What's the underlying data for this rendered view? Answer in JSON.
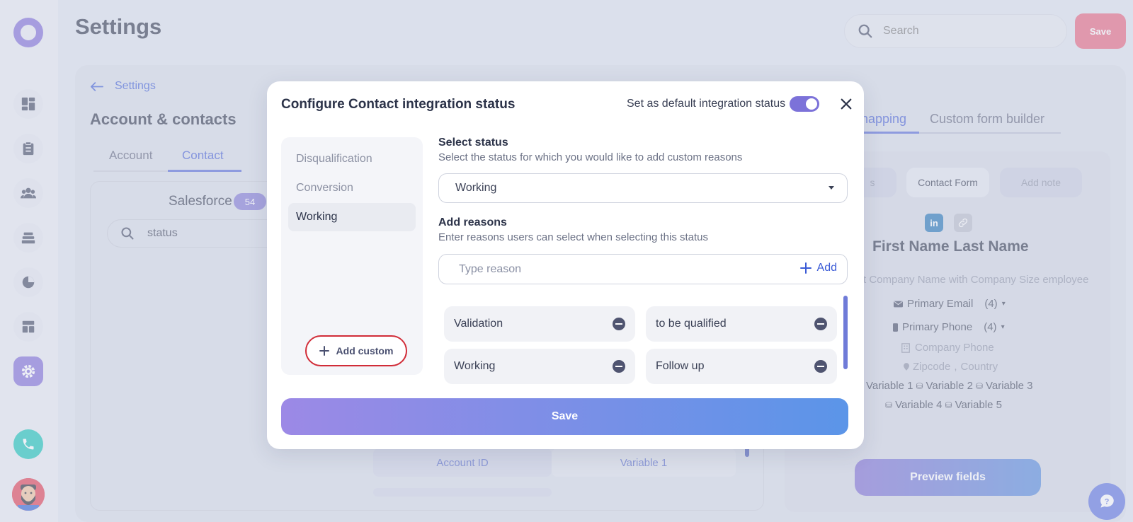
{
  "header": {
    "title": "Settings",
    "search_placeholder": "Search",
    "save_label": "Save"
  },
  "colors": {
    "accent": "#7f6ad8",
    "link": "#3b5bd6",
    "danger_outline": "#d12c38",
    "save_pink": "#e8627c"
  },
  "sidebar": {
    "items": [
      {
        "icon": "dashboard-icon"
      },
      {
        "icon": "clipboard-icon"
      },
      {
        "icon": "people-icon"
      },
      {
        "icon": "stack-icon"
      },
      {
        "icon": "pie-chart-icon"
      },
      {
        "icon": "layout-icon"
      },
      {
        "icon": "gear-icon",
        "active": true
      }
    ],
    "phone_icon": "phone-icon"
  },
  "page": {
    "back_label": "Settings",
    "section_title": "Account & contacts",
    "tabs": [
      "Account",
      "Contact"
    ],
    "active_tab": "Contact",
    "source_label": "Salesforce",
    "source_count": "54",
    "field_search_value": "status",
    "mapping_rows": [
      {
        "left": "Account ID",
        "right": "Variable 1"
      }
    ]
  },
  "right_panel": {
    "tabs": [
      "napping",
      "Custom form builder"
    ],
    "pills": [
      "s",
      "Contact Form",
      "Add note"
    ],
    "name": "First Name Last Name",
    "company_line": "t Company Name with Company Size employee",
    "email": "Primary Email",
    "email_count": "(4)",
    "phone": "Primary Phone",
    "phone_count": "(4)",
    "company_phone": "Company Phone",
    "zipcode": "Zipcode",
    "country": "Country",
    "variables_row1": [
      "Variable 1",
      "Variable 2",
      "Variable 3"
    ],
    "variables_row2": [
      "Variable 4",
      "Variable 5"
    ],
    "preview_label": "Preview fields"
  },
  "modal": {
    "title": "Configure Contact integration status",
    "default_label": "Set as default integration status",
    "default_on": true,
    "statuses": [
      "Disqualification",
      "Conversion",
      "Working"
    ],
    "selected_status": "Working",
    "add_custom_label": "Add custom",
    "select_label": "Select status",
    "select_help": "Select the status for which you would like to add custom reasons",
    "select_value": "Working",
    "reasons_label": "Add reasons",
    "reasons_help": "Enter reasons users can select when selecting this status",
    "reason_placeholder": "Type reason",
    "add_label": "Add",
    "reasons": [
      "Validation",
      "to be qualified",
      "Working",
      "Follow up"
    ],
    "save_label": "Save"
  }
}
